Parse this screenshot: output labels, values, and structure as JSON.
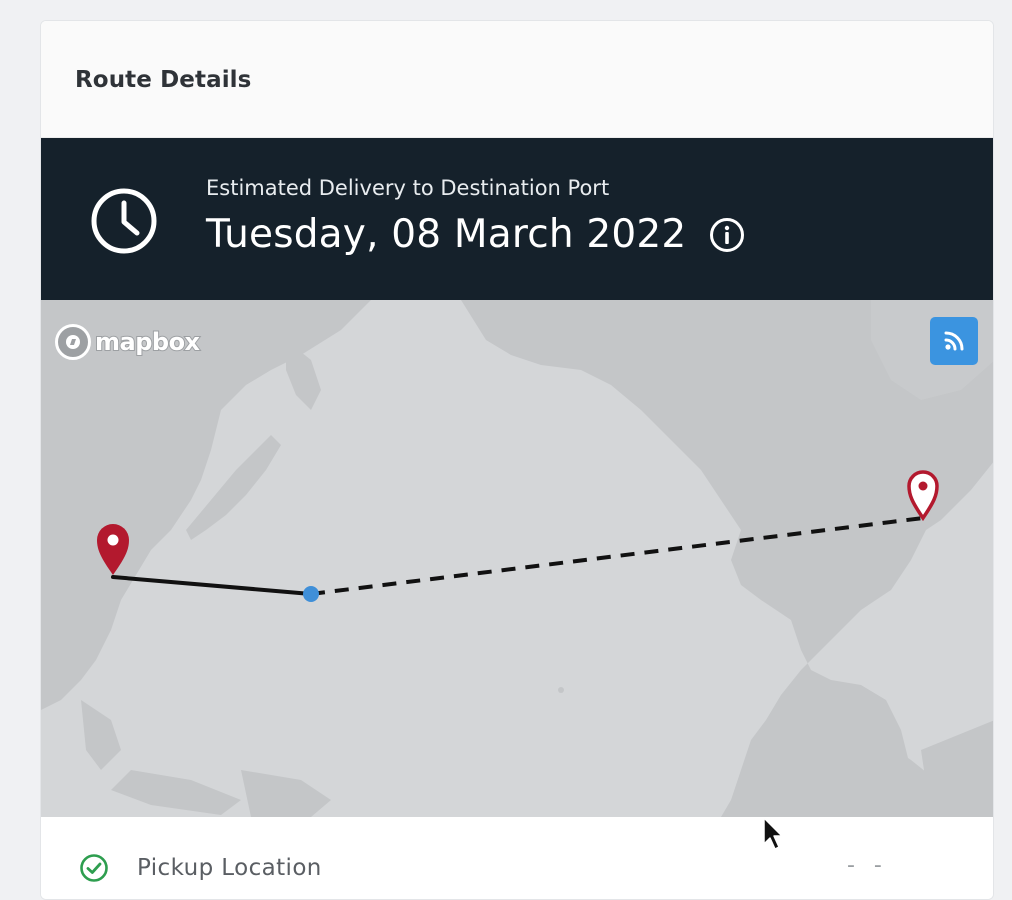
{
  "card": {
    "title": "Route Details"
  },
  "eta": {
    "label": "Estimated Delivery to Destination Port",
    "date": "Tuesday, 08 March 2022",
    "icon": "clock-icon",
    "info_icon": "info-icon"
  },
  "map": {
    "attribution": "mapbox",
    "live_button_icon": "rss-icon",
    "origin_marker_color": "#b3192e",
    "destination_marker_color": "#b3192e",
    "current_position_color": "#3f8fd8",
    "completed_route_color": "#111111",
    "remaining_route_style": "dashed"
  },
  "details": {
    "pickup_label": "Pickup Location",
    "pickup_value": "- -",
    "pickup_icon": "check-circle-icon",
    "pickup_status_color": "#2e9e4f"
  },
  "colors": {
    "banner_bg": "#15212b",
    "map_water": "#d4d6d8",
    "map_land": "#c4c6c8",
    "accent": "#3b94e0"
  }
}
